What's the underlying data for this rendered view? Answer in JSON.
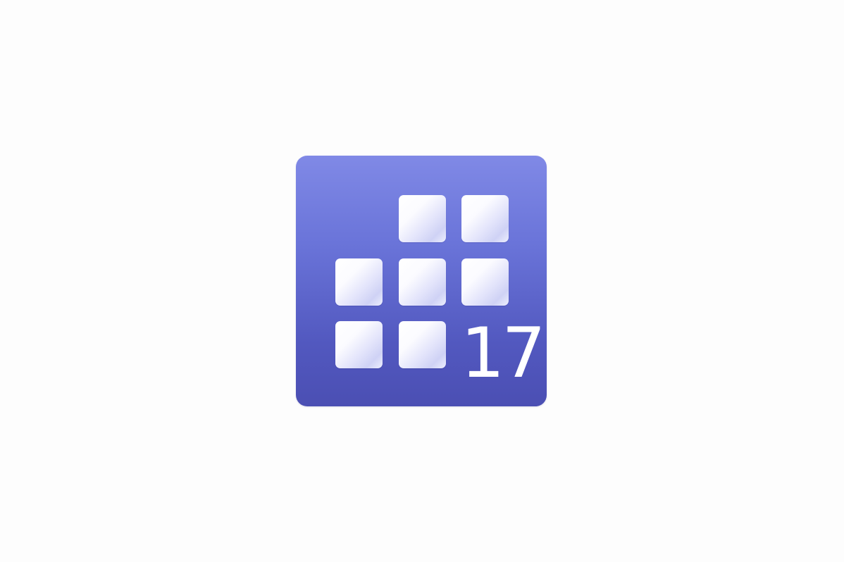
{
  "app_icon": {
    "icon_name": "calendar-grid-icon",
    "day_number": "17",
    "colors": {
      "background_top": "#8089e6",
      "background_bottom": "#4b4fb3",
      "tile": "#ffffff",
      "page": "#fdfdfd"
    },
    "grid_tiles": 7
  }
}
